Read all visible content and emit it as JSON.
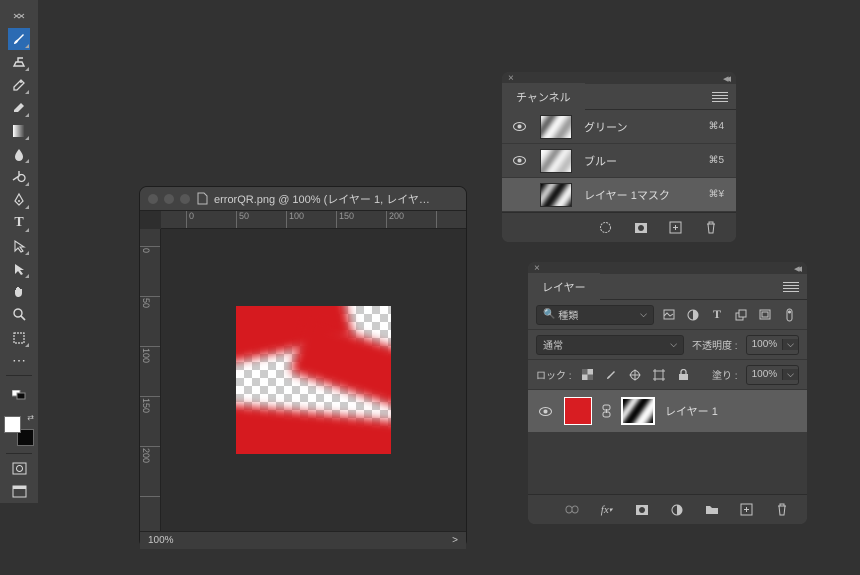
{
  "toolbar": {
    "tools": [
      {
        "name": "move-tool",
        "icon": "↕"
      },
      {
        "name": "brush-tool",
        "icon": "brush",
        "active": true
      },
      {
        "name": "clone-stamp-tool",
        "icon": "stamp"
      },
      {
        "name": "healing-brush-tool",
        "icon": "heal"
      },
      {
        "name": "eraser-tool",
        "icon": "eraser"
      },
      {
        "name": "gradient-tool",
        "icon": "gradient"
      },
      {
        "name": "blur-tool",
        "icon": "drop"
      },
      {
        "name": "dodge-tool",
        "icon": "dodge"
      },
      {
        "name": "pen-tool",
        "icon": "pen"
      },
      {
        "name": "text-tool",
        "icon": "T"
      },
      {
        "name": "path-select-tool",
        "icon": "pathsel"
      },
      {
        "name": "direct-select-tool",
        "icon": "dirsel"
      },
      {
        "name": "hand-tool",
        "icon": "hand"
      },
      {
        "name": "zoom-tool",
        "icon": "zoom"
      },
      {
        "name": "marquee-tool",
        "icon": "marquee"
      },
      {
        "name": "edit-toolbar",
        "icon": "dots"
      }
    ],
    "color_fg": "#ffffff",
    "color_bg": "#0a0a0a",
    "footer_tools": [
      {
        "name": "quick-mask-toggle",
        "icon": "quickmask"
      },
      {
        "name": "screen-mode-toggle",
        "icon": "screenmode"
      }
    ]
  },
  "document": {
    "title": "errorQR.png @ 100% (レイヤー 1, レイヤ…",
    "zoom_status": "100%",
    "status_caret": ">",
    "ruler_h": [
      "0",
      "50",
      "100",
      "150",
      "200"
    ],
    "ruler_v": [
      "0",
      "50",
      "100",
      "150",
      "200"
    ]
  },
  "channels": {
    "tab_label": "チャンネル",
    "rows": [
      {
        "name": "グリーン",
        "shortcut": "⌘4",
        "visible": true,
        "thumb": "th-g",
        "sel": false
      },
      {
        "name": "ブルー",
        "shortcut": "⌘5",
        "visible": true,
        "thumb": "th-b",
        "sel": false
      },
      {
        "name": "レイヤー 1マスク",
        "shortcut": "⌘¥",
        "visible": false,
        "thumb": "th-m",
        "sel": true
      }
    ]
  },
  "layers": {
    "tab_label": "レイヤー",
    "filter_placeholder": "種類",
    "blend_mode": "通常",
    "opacity_label": "不透明度 :",
    "opacity_value": "100%",
    "lock_label": "ロック :",
    "fill_label": "塗り :",
    "fill_value": "100%",
    "item": {
      "name": "レイヤー 1",
      "visible": true
    }
  }
}
